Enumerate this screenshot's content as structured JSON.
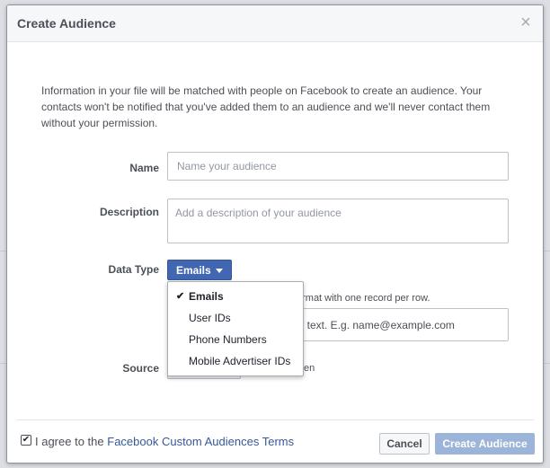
{
  "dialog": {
    "title": "Create Audience",
    "close_glyph": "×",
    "intro": "Information in your file will be matched with people on Facebook to create an audience. Your contacts won't be notified that you've added them to an audience and we'll never contact them without your permission."
  },
  "form": {
    "name_label": "Name",
    "name_placeholder": "Name your audience",
    "name_value": "",
    "description_label": "Description",
    "description_placeholder": "Add a description of your audience",
    "data_type_label": "Data Type",
    "data_type_selected": "Emails",
    "data_type_options": [
      {
        "label": "Emails",
        "selected": true
      },
      {
        "label": "User IDs",
        "selected": false
      },
      {
        "label": "Phone Numbers",
        "selected": false
      },
      {
        "label": "Mobile Advertiser IDs",
        "selected": false
      }
    ],
    "check_glyph": "✔",
    "format_hint_partial": "ormat with one record per row.",
    "file_box_partial": "in text. E.g. name@example.com",
    "source_label": "Source",
    "source_suffix_partial": "en"
  },
  "footer": {
    "agree_prefix": "I agree to the",
    "agree_link": "Facebook Custom Audiences Terms",
    "agree_checked": true,
    "checkbox_glyph": "✔",
    "cancel_label": "Cancel",
    "create_label": "Create Audience"
  },
  "colors": {
    "primary": "#4267b2",
    "link": "#365899",
    "disabled_button": "#9cb4d8"
  },
  "icons": {
    "close": "close-icon",
    "caret": "caret-down-icon",
    "check": "checkmark-icon"
  }
}
